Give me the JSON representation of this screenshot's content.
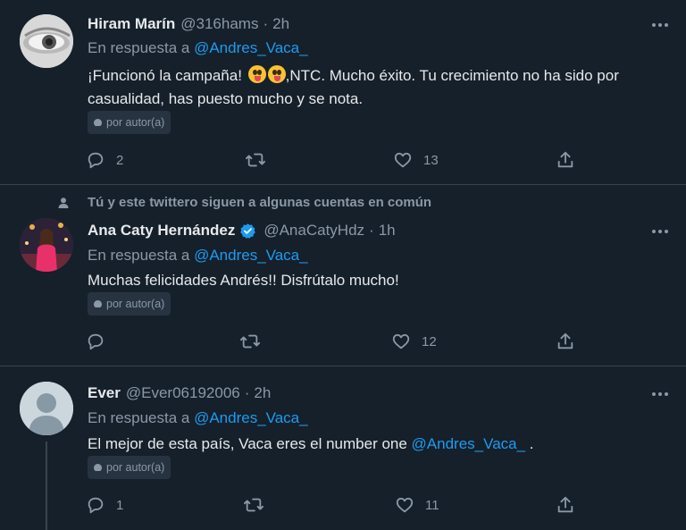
{
  "tweets": [
    {
      "name": "Hiram Marín",
      "handle": "@316hams",
      "time": "2h",
      "reply_prefix": "En respuesta a ",
      "reply_handle": "@Andres_Vaca_",
      "text_before_emoji": "¡Funcionó la campaña! ",
      "text_after_emoji": ",NTC. Mucho éxito. Tu crecimiento no ha sido por casualidad, has puesto mucho y se nota.",
      "badge": "por autor(a)",
      "replies": "2",
      "retweets": "",
      "likes": "13"
    },
    {
      "social_context": "Tú y este twittero siguen a algunas cuentas en común",
      "name": "Ana Caty Hernández",
      "verified": true,
      "handle": "@AnaCatyHdz",
      "time": "1h",
      "reply_prefix": "En respuesta a ",
      "reply_handle": "@Andres_Vaca_",
      "text": "Muchas felicidades Andrés!! Disfrútalo mucho!",
      "badge": "por autor(a)",
      "replies": "",
      "retweets": "",
      "likes": "12"
    },
    {
      "name": "Ever",
      "handle": "@Ever06192006",
      "time": "2h",
      "reply_prefix": "En respuesta a ",
      "reply_handle": "@Andres_Vaca_",
      "text": "El mejor de esta país, Vaca eres el number one ",
      "text_mention": "@Andres_Vaca_",
      "text_end": " .",
      "badge": "por autor(a)",
      "replies": "1",
      "retweets": "",
      "likes": "11"
    }
  ],
  "separator": "·",
  "colors": {
    "background": "#15202b",
    "link": "#1d9bf0",
    "muted": "#8b98a5",
    "verified": "#1d9bf0"
  },
  "icons": [
    "reply-icon",
    "retweet-icon",
    "like-icon",
    "share-icon",
    "more-icon",
    "verified-badge-icon",
    "person-icon",
    "author-badge-icon",
    "emoji-tongue-icon"
  ]
}
